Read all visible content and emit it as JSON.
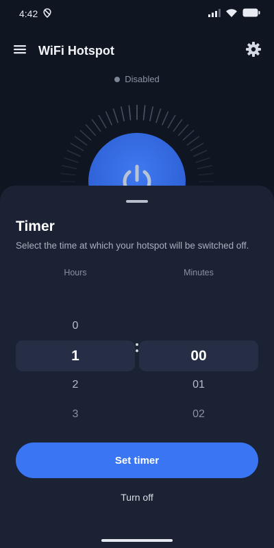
{
  "status_bar": {
    "time": "4:42",
    "icons": [
      "location-off-icon",
      "signal-icon",
      "wifi-icon",
      "battery-icon"
    ]
  },
  "app_bar": {
    "title": "WiFi Hotspot",
    "menu_icon": "hamburger-menu-icon",
    "settings_icon": "gear-icon"
  },
  "hotspot": {
    "status": "Disabled",
    "power_icon": "power-icon",
    "accent_color": "#3a76f3"
  },
  "timer_sheet": {
    "title": "Timer",
    "subtitle": "Select the time at which your hotspot will be switched off.",
    "hours": {
      "label": "Hours",
      "above": "0",
      "selected": "1",
      "below": [
        "2",
        "3"
      ]
    },
    "minutes": {
      "label": "Minutes",
      "above": "",
      "selected": "00",
      "below": [
        "01",
        "02"
      ]
    },
    "set_timer_label": "Set timer",
    "turn_off_label": "Turn off"
  }
}
